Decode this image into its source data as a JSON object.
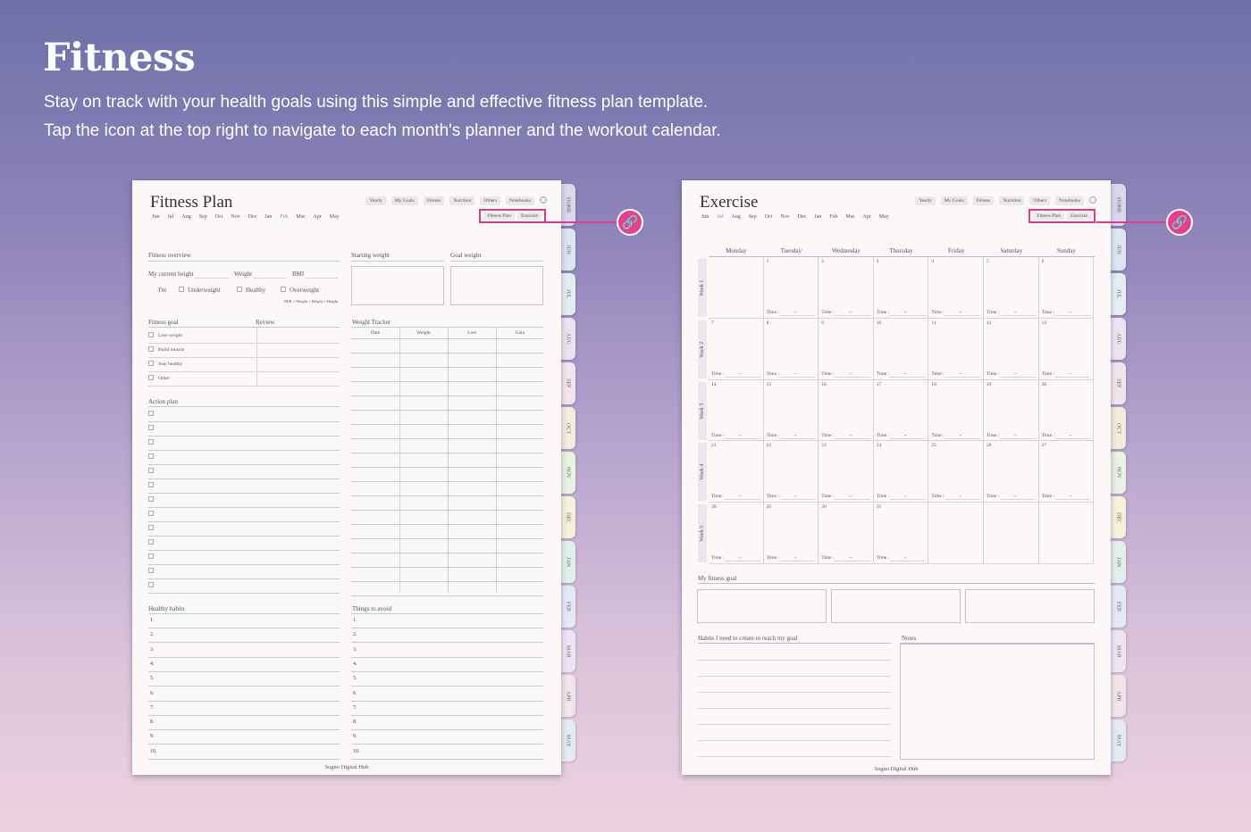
{
  "header": {
    "title": "Fitness",
    "line1": "Stay on track with your health goals using this simple and effective fitness plan template.",
    "line2": "Tap the icon at the top right to navigate to each month's planner and the workout calendar."
  },
  "nav_buttons": [
    "Yearly",
    "My Goals",
    "Fitness",
    "Nutrition",
    "Others",
    "Notebooks"
  ],
  "sub_links": {
    "fitness_plan": "Fitness Plan",
    "exercise": "Exercise"
  },
  "months_row": [
    "Jun",
    "Jul",
    "Aug",
    "Sep",
    "Oct",
    "Nov",
    "Dec",
    "Jan",
    "Feb",
    "Mar",
    "Apr",
    "May"
  ],
  "side_tabs": [
    "HOME",
    "JUN",
    "JUL",
    "AUG",
    "SEP",
    "OCT",
    "NOV",
    "DEC",
    "JAN",
    "FEB",
    "MAR",
    "APR",
    "MAY"
  ],
  "tab_colors": [
    "#d8d8ea",
    "#dde5f0",
    "#e3eef3",
    "#ece3f0",
    "#f3e4ec",
    "#f4ecdf",
    "#e9f2e3",
    "#f6f2d9",
    "#e2f0ec",
    "#e5e9f5",
    "#eee4f2",
    "#f2e5ea",
    "#e4ebf3"
  ],
  "footer": "Sogno Digital Hub",
  "fitness_plan": {
    "title": "Fitness Plan",
    "active_month": "Feb",
    "overview": "Fitness overview",
    "current_height": "My current height",
    "weight": "Weight",
    "bmi": "BMI",
    "im": "I'm",
    "underweight": "Underweight",
    "healthy": "Healthy",
    "overweight": "Overweight",
    "bmi_formula": "BMI = Weight ÷ Height × Height",
    "starting_weight": "Starting weight",
    "goal_weight": "Goal weight",
    "fitness_goal": "Fitness goal",
    "review": "Review",
    "goals": [
      "Lose weight",
      "Build muscle",
      "Stay healthy",
      "Other"
    ],
    "weight_tracker": "Weight Tracker",
    "tracker_cols": [
      "Date",
      "Weight",
      "Lost",
      "Gain"
    ],
    "action_plan": "Action plan",
    "healthy_habits": "Healthy habits",
    "things_to_avoid": "Things to avoid",
    "numbers": [
      "1.",
      "2.",
      "3.",
      "4.",
      "5.",
      "6.",
      "7.",
      "8.",
      "9.",
      "10."
    ]
  },
  "exercise": {
    "title": "Exercise",
    "active_month": "Jul",
    "days": [
      "Monday",
      "Tuesday",
      "Wednesday",
      "Thursday",
      "Friday",
      "Saturday",
      "Sunday"
    ],
    "weeks": [
      "Week 1",
      "Week 2",
      "Week 3",
      "Week 4",
      "Week 5"
    ],
    "dates": [
      [
        "",
        "1",
        "2",
        "3",
        "4",
        "5",
        "6"
      ],
      [
        "7",
        "8",
        "9",
        "10",
        "11",
        "12",
        "13"
      ],
      [
        "14",
        "15",
        "16",
        "17",
        "18",
        "19",
        "20"
      ],
      [
        "21",
        "22",
        "23",
        "24",
        "25",
        "26",
        "27"
      ],
      [
        "28",
        "29",
        "30",
        "31",
        "",
        "",
        ""
      ]
    ],
    "time_label": "Time :",
    "time_sep": "~",
    "my_fitness_goal": "My fitness goal",
    "habits_label": "Habits I need to create to reach my goal",
    "notes": "Notes"
  }
}
